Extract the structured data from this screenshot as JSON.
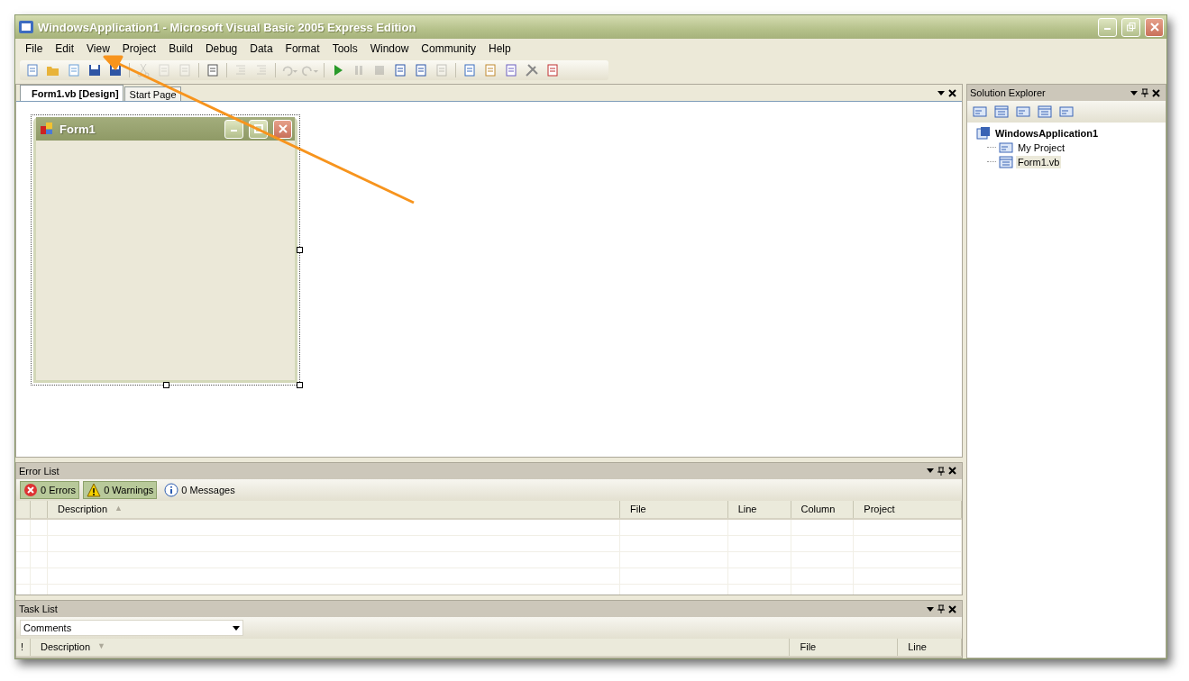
{
  "window": {
    "title": "WindowsApplication1 - Microsoft Visual Basic 2005 Express Edition"
  },
  "menu": [
    "File",
    "Edit",
    "View",
    "Project",
    "Build",
    "Debug",
    "Data",
    "Format",
    "Tools",
    "Window",
    "Community",
    "Help"
  ],
  "toolbar": [
    {
      "kind": "new-project",
      "disabled": false
    },
    {
      "kind": "open",
      "disabled": false
    },
    {
      "kind": "add-item",
      "disabled": false
    },
    {
      "kind": "save",
      "disabled": false
    },
    {
      "kind": "save-all",
      "disabled": false
    },
    {
      "kind": "sep"
    },
    {
      "kind": "cut",
      "disabled": true
    },
    {
      "kind": "copy",
      "disabled": true
    },
    {
      "kind": "paste",
      "disabled": true
    },
    {
      "kind": "sep"
    },
    {
      "kind": "find",
      "disabled": false
    },
    {
      "kind": "sep"
    },
    {
      "kind": "indent",
      "disabled": true
    },
    {
      "kind": "outdent",
      "disabled": true
    },
    {
      "kind": "sep"
    },
    {
      "kind": "undo",
      "disabled": true
    },
    {
      "kind": "redo",
      "disabled": true
    },
    {
      "kind": "sep"
    },
    {
      "kind": "run",
      "disabled": false
    },
    {
      "kind": "pause",
      "disabled": true
    },
    {
      "kind": "stop",
      "disabled": true
    },
    {
      "kind": "step-into",
      "disabled": false
    },
    {
      "kind": "step-over",
      "disabled": false
    },
    {
      "kind": "step-out",
      "disabled": true
    },
    {
      "kind": "sep"
    },
    {
      "kind": "explorer",
      "disabled": false
    },
    {
      "kind": "properties",
      "disabled": false
    },
    {
      "kind": "browser",
      "disabled": false
    },
    {
      "kind": "toolbox",
      "disabled": false
    },
    {
      "kind": "tasks",
      "disabled": false
    }
  ],
  "editor": {
    "tabs": [
      {
        "label": "Form1.vb [Design]",
        "selected": true
      },
      {
        "label": "Start Page",
        "selected": false
      }
    ],
    "form": {
      "title": "Form1"
    }
  },
  "error_list": {
    "title": "Error List",
    "filters": [
      {
        "kind": "error",
        "label": "0 Errors",
        "selected": true
      },
      {
        "kind": "warning",
        "label": "0 Warnings",
        "selected": true
      },
      {
        "kind": "info",
        "label": "0 Messages",
        "selected": false
      }
    ],
    "columns": [
      {},
      {},
      {
        "label": "Description",
        "sort_mark": "▲"
      },
      {
        "label": "File"
      },
      {
        "label": "Line"
      },
      {
        "label": "Column"
      },
      {
        "label": "Project"
      }
    ]
  },
  "task_list": {
    "title": "Task List",
    "filter": "Comments",
    "columns": [
      {
        "label": "!"
      },
      {
        "label": "Description",
        "sort_mark": "▼"
      },
      {
        "label": "File"
      },
      {
        "label": "Line"
      }
    ]
  },
  "solution_explorer": {
    "title": "Solution Explorer",
    "tree": [
      {
        "label": "WindowsApplication1",
        "kind": "project",
        "selected": false,
        "children": [
          {
            "label": "My Project",
            "kind": "settings",
            "selected": false
          },
          {
            "label": "Form1.vb",
            "kind": "form",
            "selected": true
          }
        ]
      }
    ]
  }
}
